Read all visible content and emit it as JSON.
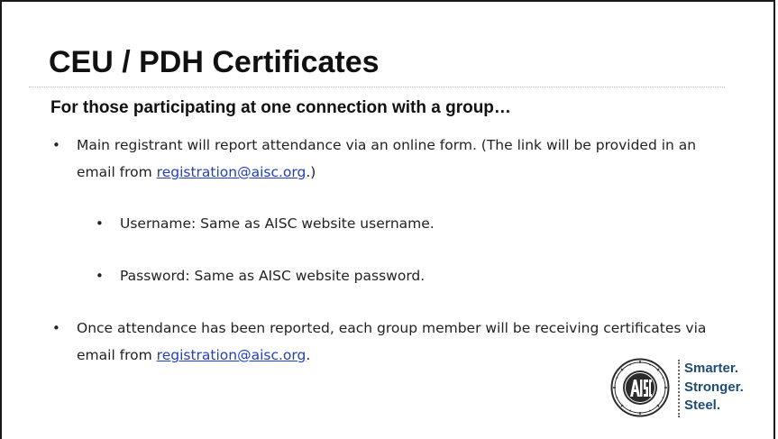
{
  "slide": {
    "title": "CEU / PDH Certificates",
    "subtitle": "For those participating at one connection with a group…",
    "bullet_glyph": "•",
    "bullets": [
      {
        "text_before": "Main registrant will report attendance via an online form.  (The link will be provided in an email from ",
        "link": "registration@aisc.org",
        "text_after": ".)"
      },
      {
        "text": "Username:  Same as AISC website username."
      },
      {
        "text": "Password:  Same as AISC website password."
      },
      {
        "text_before": "Once attendance has been reported, each group member will be receiving certificates via email from ",
        "link": "registration@aisc.org",
        "text_after": "."
      }
    ]
  },
  "logo": {
    "tagline": [
      "Smarter.",
      "Stronger.",
      "Steel."
    ],
    "tagline_color": "#1e4c73",
    "seal_text": "AMERICAN INSTITUTE OF STEEL CONSTRUCTION",
    "seal_center": "AISC",
    "seal_founded": "FOUNDED 1921"
  },
  "colors": {
    "text": "#222222",
    "link": "#1f3fbf",
    "brand": "#1e4c73"
  }
}
